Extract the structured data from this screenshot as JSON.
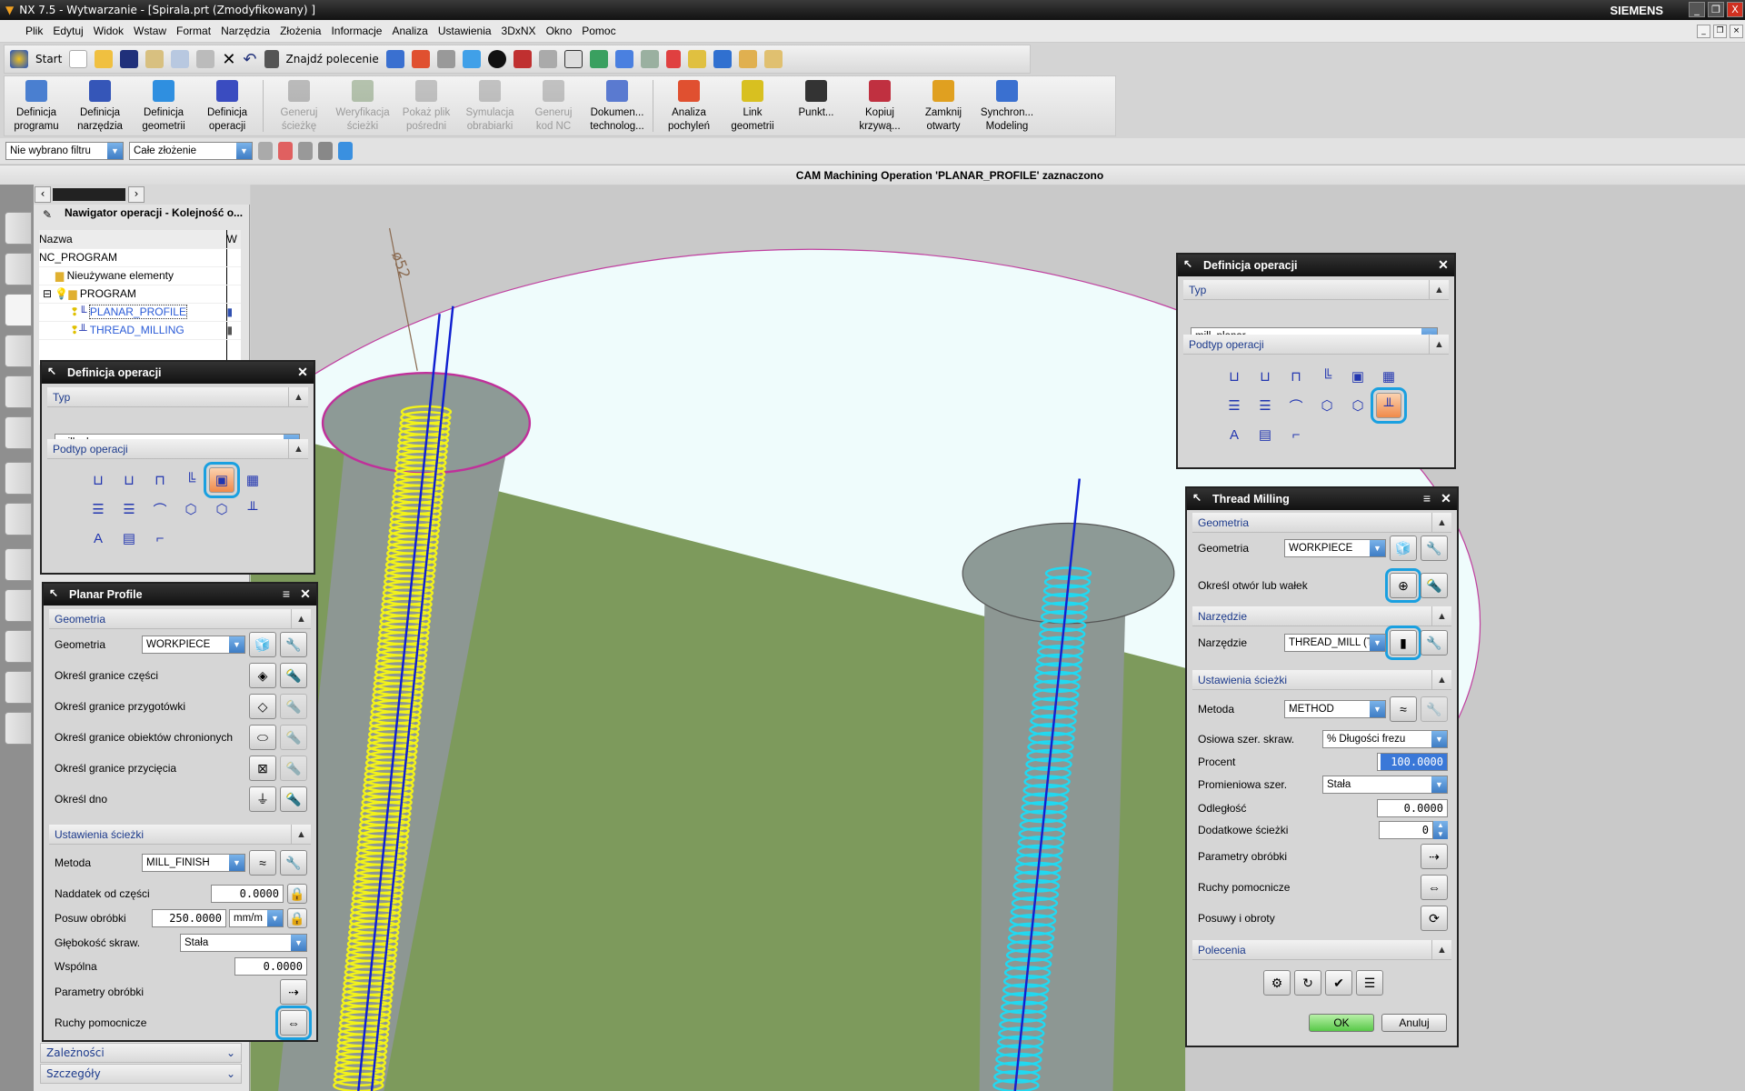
{
  "window": {
    "title": "NX 7.5 - Wytwarzanie - [Spirala.prt (Zmodyfikowany) ]",
    "brand": "SIEMENS"
  },
  "menu": [
    "Plik",
    "Edytuj",
    "Widok",
    "Wstaw",
    "Format",
    "Narzędzia",
    "Złożenia",
    "Informacje",
    "Analiza",
    "Ustawienia",
    "3DxNX",
    "Okno",
    "Pomoc"
  ],
  "toolbar": {
    "start": "Start",
    "find": "Znajdź polecenie"
  },
  "ribbon": [
    {
      "l1": "Definicja",
      "l2": "programu",
      "enabled": true,
      "color": "#4a7fd0"
    },
    {
      "l1": "Definicja",
      "l2": "narzędzia",
      "enabled": true,
      "color": "#3556b8"
    },
    {
      "l1": "Definicja",
      "l2": "geometrii",
      "enabled": true,
      "color": "#2f8fe0"
    },
    {
      "l1": "Definicja",
      "l2": "operacji",
      "enabled": true,
      "color": "#3a4cc0"
    },
    {
      "l1": "Generuj",
      "l2": "ścieżkę",
      "enabled": false,
      "color": "#777"
    },
    {
      "l1": "Weryfikacja",
      "l2": "ścieżki",
      "enabled": false,
      "color": "#6a8a5a"
    },
    {
      "l1": "Pokaż plik",
      "l2": "pośredni",
      "enabled": false,
      "color": "#888"
    },
    {
      "l1": "Symulacja",
      "l2": "obrabiarki",
      "enabled": false,
      "color": "#888"
    },
    {
      "l1": "Generuj",
      "l2": "kod NC",
      "enabled": false,
      "color": "#888"
    },
    {
      "l1": "Dokumen...",
      "l2": "technolog...",
      "enabled": true,
      "color": "#5a7ad0"
    },
    {
      "l1": "Analiza",
      "l2": "pochyleń",
      "enabled": true,
      "color": "#e05030"
    },
    {
      "l1": "Link",
      "l2": "geometrii",
      "enabled": true,
      "color": "#d8c020"
    },
    {
      "l1": "Punkt...",
      "l2": "",
      "enabled": true,
      "color": "#333"
    },
    {
      "l1": "Kopiuj",
      "l2": "krzywą...",
      "enabled": true,
      "color": "#c03040"
    },
    {
      "l1": "Zamknij",
      "l2": "otwarty",
      "enabled": true,
      "color": "#e0a020"
    },
    {
      "l1": "Synchron...",
      "l2": "Modeling",
      "enabled": true,
      "color": "#3a70d0"
    }
  ],
  "filter": {
    "selection_filter": "Nie wybrano filtru",
    "scope": "Całe złożenie"
  },
  "status": "CAM Machining Operation 'PLANAR_PROFILE' zaznaczono",
  "navigator": {
    "title": "Nawigator operacji - Kolejność o...",
    "col_name": "Nazwa",
    "col_w": "W",
    "rows": [
      {
        "name": "NC_PROGRAM"
      },
      {
        "name": "Nieużywane elementy"
      },
      {
        "name": "PROGRAM"
      },
      {
        "name": "PLANAR_PROFILE"
      },
      {
        "name": "THREAD_MILLING"
      }
    ]
  },
  "def_left": {
    "title": "Definicja operacji",
    "typ_label": "Typ",
    "typ_value": "mill_planar",
    "subtype_label": "Podtyp operacji"
  },
  "def_right": {
    "title": "Definicja operacji",
    "typ_label": "Typ",
    "typ_value": "mill_planar",
    "subtype_label": "Podtyp operacji"
  },
  "planar": {
    "title": "Planar Profile",
    "geom_header": "Geometria",
    "geometria_label": "Geometria",
    "geometria_value": "WORKPIECE",
    "part": "Określ granice części",
    "blank": "Określ granice przygotówki",
    "check": "Określ granice obiektów chronionych",
    "trim": "Określ granice przycięcia",
    "floor": "Określ dno",
    "path_header": "Ustawienia ścieżki",
    "method_label": "Metoda",
    "method_value": "MILL_FINISH",
    "stock_label": "Naddatek od części",
    "stock_value": "0.0000",
    "feed_label": "Posuw obróbki",
    "feed_value": "250.0000",
    "feed_unit": "mm/m",
    "depth_label": "Głębokość skraw.",
    "depth_value": "Stała",
    "common_label": "Wspólna",
    "common_value": "0.0000",
    "cut_params": "Parametry obróbki",
    "non_cut": "Ruchy pomocnicze"
  },
  "nav_bottom": {
    "deps": "Zależności",
    "details": "Szczegóły"
  },
  "thread": {
    "title": "Thread Milling",
    "geom_header": "Geometria",
    "geometria_label": "Geometria",
    "geometria_value": "WORKPIECE",
    "hole": "Określ otwór lub wałek",
    "tool_header": "Narzędzie",
    "tool_label": "Narzędzie",
    "tool_value": "THREAD_MILL (TI",
    "path_header": "Ustawienia ścieżki",
    "method_label": "Metoda",
    "method_value": "METHOD",
    "axial_label": "Osiowa szer. skraw.",
    "axial_value": "% Długości frezu",
    "percent_label": "Procent",
    "percent_value": "100.0000",
    "radial_label": "Promieniowa szer.",
    "radial_value": "Stała",
    "distance_label": "Odległość",
    "distance_value": "0.0000",
    "extra_label": "Dodatkowe ścieżki",
    "extra_value": "0",
    "cut_params": "Parametry obróbki",
    "non_cut": "Ruchy pomocnicze",
    "feeds": "Posuwy i obroty",
    "actions_header": "Polecenia",
    "ok": "OK",
    "cancel": "Anuluj"
  },
  "viewport": {
    "dimension": "ø52",
    "colors": {
      "plane": "#7d9a5c",
      "sky": "#effcfc",
      "bg": "#c9c9c9",
      "pillar": "#8d9793",
      "yellow": "#f2f21a",
      "cyan": "#22d8f0",
      "axis": "#1020d0"
    }
  }
}
